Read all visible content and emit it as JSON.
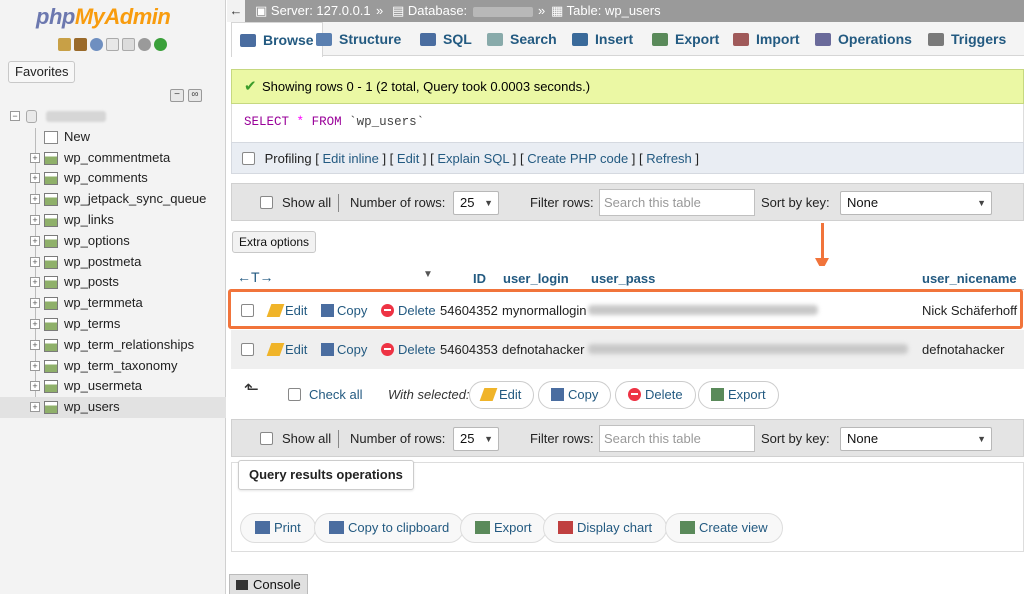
{
  "sidebar": {
    "logo_php": "php",
    "logo_myadmin": "MyAdmin",
    "favorites": "Favorites",
    "new_label": "New",
    "tables": [
      "wp_commentmeta",
      "wp_comments",
      "wp_jetpack_sync_queue",
      "wp_links",
      "wp_options",
      "wp_postmeta",
      "wp_posts",
      "wp_termmeta",
      "wp_terms",
      "wp_term_relationships",
      "wp_term_taxonomy",
      "wp_usermeta",
      "wp_users"
    ],
    "selected_table": "wp_users"
  },
  "topbar": {
    "server": "Server: 127.0.0.1",
    "database": "Database:",
    "table": "Table: wp_users",
    "sep": "»"
  },
  "tabs": [
    "Browse",
    "Structure",
    "SQL",
    "Search",
    "Insert",
    "Export",
    "Import",
    "Operations",
    "Triggers"
  ],
  "success": "Showing rows 0 - 1 (2 total, Query took 0.0003 seconds.)",
  "sql": {
    "select": "SELECT",
    "star": "*",
    "from": "FROM",
    "table": "`wp_users`"
  },
  "profiling": {
    "label": "Profiling",
    "links": [
      "Edit inline",
      "Edit",
      "Explain SQL",
      "Create PHP code",
      "Refresh"
    ]
  },
  "navbar": {
    "show_all": "Show all",
    "num_rows_label": "Number of rows:",
    "num_rows_value": "25",
    "filter_label": "Filter rows:",
    "filter_placeholder": "Search this table",
    "sort_label": "Sort by key:",
    "sort_value": "None"
  },
  "extra_options": "Extra options",
  "table": {
    "arrows": "←T→",
    "columns": [
      "ID",
      "user_login",
      "user_pass",
      "user_nicename"
    ],
    "rows": [
      {
        "id": "54604352",
        "login": "mynormallogin",
        "nicename": "Nick Schäferhoff"
      },
      {
        "id": "54604353",
        "login": "defnotahacker",
        "nicename": "defnotahacker"
      }
    ],
    "actions": {
      "edit": "Edit",
      "copy": "Copy",
      "delete": "Delete"
    }
  },
  "with_selected": {
    "check_all": "Check all",
    "label": "With selected:",
    "buttons": [
      "Edit",
      "Copy",
      "Delete",
      "Export"
    ]
  },
  "query_ops": {
    "title": "Query results operations",
    "buttons": [
      "Print",
      "Copy to clipboard",
      "Export",
      "Display chart",
      "Create view"
    ]
  },
  "console": "Console",
  "colors": {
    "link": "#235a81",
    "success_bg": "#ebf8a4",
    "highlight": "#f1743b"
  }
}
